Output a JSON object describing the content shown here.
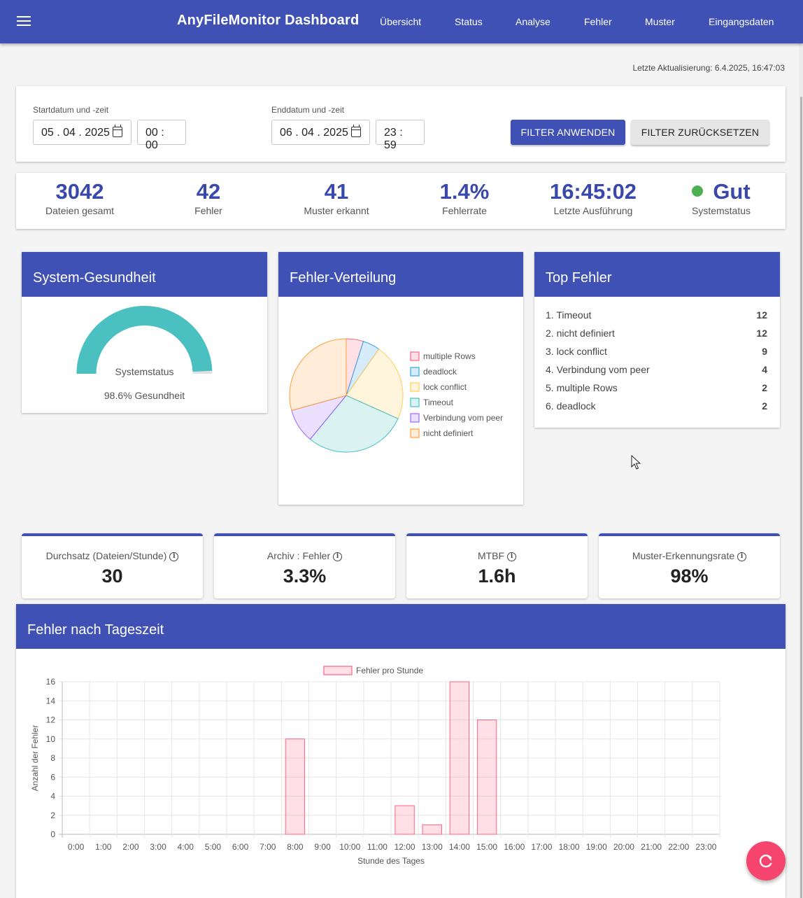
{
  "app": {
    "title": "AnyFileMonitor Dashboard",
    "nav": [
      "Übersicht",
      "Status",
      "Analyse",
      "Fehler",
      "Muster",
      "Eingangsdaten"
    ],
    "icons": {
      "menu": "menu-icon",
      "refresh": "refresh-icon",
      "calendar": "calendar-icon",
      "info": "info-icon"
    },
    "colors": {
      "primary": "#3f51b5",
      "accent": "#f5456f",
      "ok": "#4caf50",
      "gauge": "#4bc0c0"
    }
  },
  "last_update": "Letzte Aktualisierung: 6.4.2025, 16:47:03",
  "filter": {
    "start_label": "Startdatum und -zeit",
    "start_date": "05 . 04 . 2025",
    "start_time": "00 : 00",
    "end_label": "Enddatum und -zeit",
    "end_date": "06 . 04 . 2025",
    "end_time": "23 : 59",
    "apply": "FILTER ANWENDEN",
    "reset": "FILTER ZURÜCKSETZEN"
  },
  "kpis": [
    {
      "value": "3042",
      "label": "Dateien gesamt"
    },
    {
      "value": "42",
      "label": "Fehler"
    },
    {
      "value": "41",
      "label": "Muster erkannt"
    },
    {
      "value": "1.4%",
      "label": "Fehlerrate"
    },
    {
      "value": "16:45:02",
      "label": "Letzte Ausführung"
    },
    {
      "value": "Gut",
      "label": "Systemstatus"
    }
  ],
  "health": {
    "title": "System-Gesundheit",
    "gauge_label": "Systemstatus",
    "caption": "98.6% Gesundheit",
    "value": 0.986
  },
  "distribution": {
    "title": "Fehler-Verteilung",
    "legend": [
      "multiple Rows",
      "deadlock",
      "lock conflict",
      "Timeout",
      "Verbindung vom peer",
      "nicht definiert"
    ]
  },
  "top_errors": {
    "title": "Top Fehler",
    "items": [
      {
        "label": "1. Timeout",
        "count": "12"
      },
      {
        "label": "2. nicht definiert",
        "count": "12"
      },
      {
        "label": "3. lock conflict",
        "count": "9"
      },
      {
        "label": "4. Verbindung vom peer",
        "count": "4"
      },
      {
        "label": "5. multiple Rows",
        "count": "2"
      },
      {
        "label": "6. deadlock",
        "count": "2"
      }
    ]
  },
  "metrics": [
    {
      "label": "Durchsatz (Dateien/Stunde)",
      "value": "30"
    },
    {
      "label": "Archiv : Fehler",
      "value": "3.3%"
    },
    {
      "label": "MTBF",
      "value": "1.6h"
    },
    {
      "label": "Muster-Erkennungsrate",
      "value": "98%"
    }
  ],
  "hourly": {
    "title": "Fehler nach Tageszeit"
  },
  "chart_data": [
    {
      "type": "pie",
      "labels": [
        "multiple Rows",
        "deadlock",
        "lock conflict",
        "Timeout",
        "Verbindung vom peer",
        "nicht definiert"
      ],
      "values": [
        2,
        2,
        9,
        12,
        4,
        12
      ],
      "colors": [
        "#ff6384",
        "#36a2eb",
        "#ffce56",
        "#4bc0c0",
        "#9966ff",
        "#ff9f40"
      ]
    },
    {
      "type": "bar",
      "categories": [
        "0:00",
        "1:00",
        "2:00",
        "3:00",
        "4:00",
        "5:00",
        "6:00",
        "7:00",
        "8:00",
        "9:00",
        "10:00",
        "11:00",
        "12:00",
        "13:00",
        "14:00",
        "15:00",
        "16:00",
        "17:00",
        "18:00",
        "19:00",
        "20:00",
        "21:00",
        "22:00",
        "23:00"
      ],
      "series": [
        {
          "name": "Fehler pro Stunde",
          "values": [
            0,
            0,
            0,
            0,
            0,
            0,
            0,
            0,
            10,
            0,
            0,
            0,
            3,
            1,
            16,
            12,
            0,
            0,
            0,
            0,
            0,
            0,
            0,
            0
          ]
        }
      ],
      "xlabel": "Stunde des Tages",
      "ylabel": "Anzahl der Fehler",
      "ylim": [
        0,
        16
      ],
      "yticks": [
        0,
        2,
        4,
        6,
        8,
        10,
        12,
        14,
        16
      ],
      "grid": true,
      "legend": "top",
      "color": "#ff6384"
    }
  ]
}
